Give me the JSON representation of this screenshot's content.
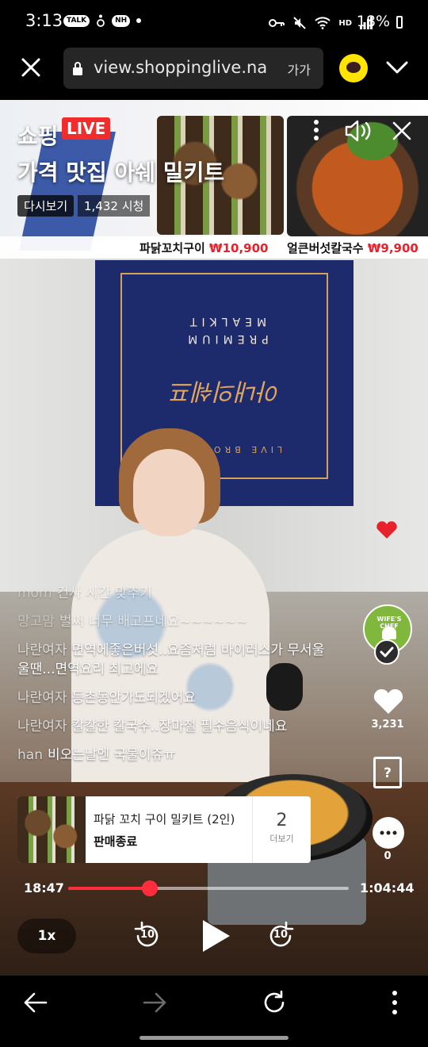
{
  "status_bar": {
    "time": "3:13",
    "left_icons": [
      "talk-icon",
      "wheelchair-icon",
      "nh-icon",
      "dot-icon"
    ],
    "talk_label": "TALK",
    "nh_label": "NH",
    "right_icons": [
      "key-icon",
      "mute-icon",
      "wifi-icon",
      "hd-voice-icon",
      "signal-icon"
    ],
    "hd_label": "HD",
    "battery": "18%"
  },
  "browser": {
    "url": "view.shoppinglive.na",
    "text_size_label": "가가",
    "icons": [
      "close-icon",
      "lock-icon",
      "kakao-talk-icon",
      "chevron-down-icon"
    ]
  },
  "banner": {
    "brand": "쇼핑",
    "live_label": "LIVE",
    "title": "가격 맛집 아쉐 밀키트",
    "replay_label": "다시보기",
    "view_count": "1,432 시청",
    "products": [
      {
        "name": "파닭꼬치구이",
        "price": "₩10,900"
      },
      {
        "name": "얼큰버섯칼국수",
        "price": "₩9,900"
      }
    ],
    "icons": [
      "more-vertical-icon",
      "sound-icon",
      "close-icon"
    ]
  },
  "video": {
    "wall_logo_top": "PREMIUM\nMEALKIT",
    "wall_logo_script": "아내의쉐프",
    "wall_logo_bottom": "LIVE BROADCA"
  },
  "chat": [
    {
      "user": "mom",
      "message": "건사 시간 맞추기",
      "faded": true
    },
    {
      "user": "망고맘",
      "message": "벌써 너무 배고프네요~~~~~~",
      "faded": true
    },
    {
      "user": "나란여자",
      "message": "면역에좋은버섯..요즘처럼 바이러스가 무서울울땐...면역요리 최고에요",
      "faded": false
    },
    {
      "user": "나란여자",
      "message": "등촌동안가도되겠어요",
      "faded": false
    },
    {
      "user": "나란여자",
      "message": "칼칼한 칼국수..장마철 필수음식이네요",
      "faded": false
    },
    {
      "user": "han",
      "message": "비오는날엔 국물이쥬ㅠ",
      "faded": false
    }
  ],
  "side_actions": {
    "chef_logo_text": "WIFE'S CHEF",
    "like_count": "3,231",
    "product_bag_label": "?",
    "comment_count": "0"
  },
  "product_card": {
    "name": "파닭 꼬치 구이 밀키트 (2인)",
    "status": "판매종료",
    "more_count": "2",
    "more_label": "더보기"
  },
  "playback": {
    "current_time": "18:47",
    "total_time": "1:04:44",
    "progress_fraction": 0.29,
    "speed": "1x",
    "seek_back": "10",
    "seek_forward": "10"
  },
  "colors": {
    "live_red": "#f02c2c",
    "progress_red": "#ff2e3c",
    "kakao_yellow": "#fee500",
    "price_red": "#e8222c"
  },
  "bottom_nav": {
    "icons": [
      "back-arrow-icon",
      "forward-arrow-icon",
      "refresh-icon",
      "more-vertical-icon"
    ]
  }
}
